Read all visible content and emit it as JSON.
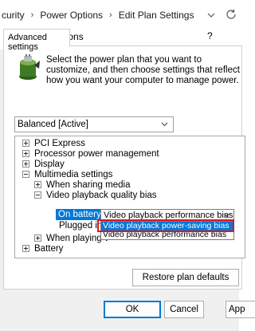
{
  "breadcrumb": {
    "items": [
      "curity",
      "Power Options",
      "Edit Plan Settings"
    ],
    "separator": "›"
  },
  "dialog": {
    "title": "Power Options",
    "help": "?",
    "tab": "Advanced settings",
    "intro": "Select the power plan that you want to customize, and then choose settings that reflect how you want your computer to manage power.",
    "plan_selected": "Balanced [Active]"
  },
  "tree": {
    "items": [
      {
        "label": "PCI Express",
        "expander": "plus"
      },
      {
        "label": "Processor power management",
        "expander": "plus"
      },
      {
        "label": "Display",
        "expander": "plus"
      },
      {
        "label": "Multimedia settings",
        "expander": "minus"
      },
      {
        "label": "When sharing media",
        "expander": "plus"
      },
      {
        "label": "Video playback quality bias",
        "expander": "minus"
      },
      {
        "label": "When playing v",
        "expander": "plus"
      },
      {
        "label": "Battery",
        "expander": "plus"
      }
    ],
    "on_battery_label": "On battery:",
    "plugged_in_label": "Plugged in",
    "bias_selected": "Video playback performance bias",
    "bias_options": [
      "Video playback power-saving bias",
      "Video playback performance bias"
    ]
  },
  "buttons": {
    "restore": "Restore plan defaults",
    "ok": "OK",
    "cancel": "Cancel",
    "apply": "App"
  },
  "colors": {
    "accent": "#0078d7",
    "highlight_frame": "#e1141e"
  }
}
